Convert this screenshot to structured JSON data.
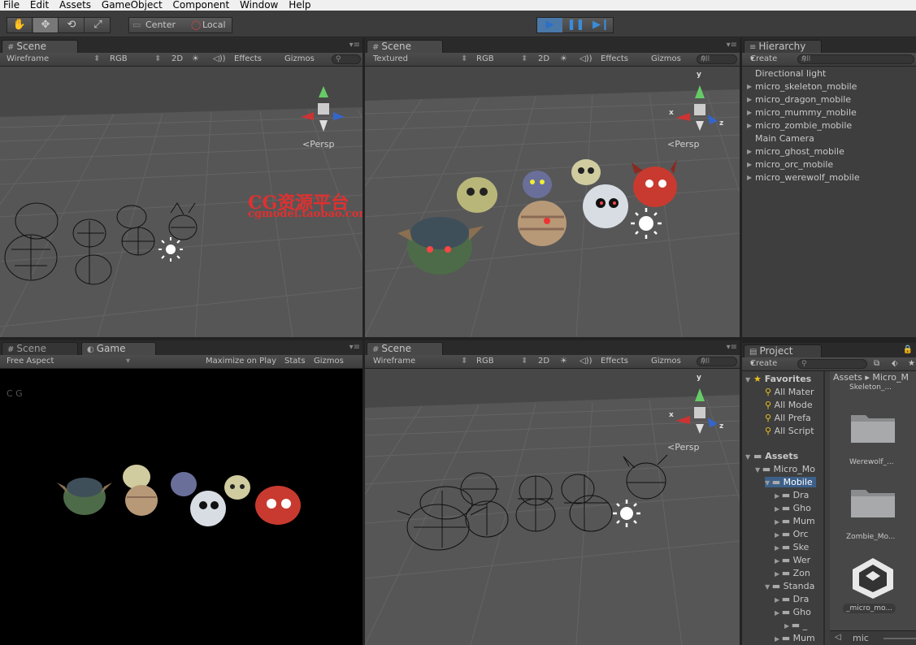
{
  "menu": [
    "File",
    "Edit",
    "Assets",
    "GameObject",
    "Component",
    "Window",
    "Help"
  ],
  "toolbar": {
    "tools": [
      {
        "name": "hand-icon",
        "glyph": "✋"
      },
      {
        "name": "move-icon",
        "glyph": "✥"
      },
      {
        "name": "rotate-icon",
        "glyph": "⟲"
      },
      {
        "name": "scale-icon",
        "glyph": "⤢"
      }
    ],
    "pivot_label": "Center",
    "space_label": "Local",
    "play_glyph": "▶",
    "pause_glyph": "❚❚",
    "step_glyph": "▶❙"
  },
  "scene_tl": {
    "tab": "Scene",
    "draw_mode": "Wireframe",
    "render_mode": "RGB",
    "btn_2d": "2D",
    "effects": "Effects",
    "gizmos": "Gizmos",
    "search": "All",
    "persp": "Persp"
  },
  "scene_tr": {
    "tab": "Scene",
    "draw_mode": "Textured",
    "render_mode": "RGB",
    "btn_2d": "2D",
    "effects": "Effects",
    "gizmos": "Gizmos",
    "search": "All",
    "persp": "Persp",
    "axis_y": "y",
    "axis_x": "x",
    "axis_z": "z"
  },
  "scene_br": {
    "tab": "Scene",
    "draw_mode": "Wireframe",
    "render_mode": "RGB",
    "btn_2d": "2D",
    "effects": "Effects",
    "gizmos": "Gizmos",
    "search": "All",
    "persp": "Persp",
    "axis_y": "y",
    "axis_x": "x",
    "axis_z": "z"
  },
  "game_panel": {
    "scene_tab": "Scene",
    "game_tab": "Game",
    "aspect": "Free Aspect",
    "maximize": "Maximize on Play",
    "stats": "Stats",
    "gizmos": "Gizmos"
  },
  "hierarchy": {
    "tab": "Hierarchy",
    "create": "Create",
    "search": "All",
    "items": [
      {
        "label": "Directional light",
        "expandable": false
      },
      {
        "label": "micro_skeleton_mobile",
        "expandable": true
      },
      {
        "label": "micro_dragon_mobile",
        "expandable": true
      },
      {
        "label": "micro_mummy_mobile",
        "expandable": true
      },
      {
        "label": "micro_zombie_mobile",
        "expandable": true
      },
      {
        "label": "Main Camera",
        "expandable": false
      },
      {
        "label": "micro_ghost_mobile",
        "expandable": true
      },
      {
        "label": "micro_orc_mobile",
        "expandable": true
      },
      {
        "label": "micro_werewolf_mobile",
        "expandable": true
      }
    ]
  },
  "project": {
    "tab": "Project",
    "create": "Create",
    "favorites_label": "Favorites",
    "favorites": [
      "All Mater",
      "All Mode",
      "All Prefa",
      "All Script"
    ],
    "assets_label": "Assets",
    "tree": [
      {
        "label": "Micro_Mo",
        "indent": 1
      },
      {
        "label": "Mobile",
        "indent": 2
      },
      {
        "label": "Dra",
        "indent": 3
      },
      {
        "label": "Gho",
        "indent": 3
      },
      {
        "label": "Mum",
        "indent": 3
      },
      {
        "label": "Orc",
        "indent": 3
      },
      {
        "label": "Ske",
        "indent": 3
      },
      {
        "label": "Wer",
        "indent": 3
      },
      {
        "label": "Zon",
        "indent": 3
      },
      {
        "label": "Standa",
        "indent": 2
      },
      {
        "label": "Dra",
        "indent": 3
      },
      {
        "label": "Gho",
        "indent": 3
      },
      {
        "label": "_",
        "indent": 4
      },
      {
        "label": "Mum",
        "indent": 3
      }
    ],
    "breadcrumb_root": "Assets",
    "breadcrumb_sep": "▸",
    "breadcrumb_child": "Micro_M",
    "thumbs": [
      "Skeleton_...",
      "Werewolf_...",
      "Zombie_Mo...",
      "_micro_mo..."
    ],
    "footer_search": "mic"
  },
  "watermark": {
    "title": "CG资源平台",
    "url": "cgmodel.taobao.com",
    "diag": "cgmodel.taobao.com",
    "cn": "资 源 平 台",
    "cg": "C G"
  }
}
